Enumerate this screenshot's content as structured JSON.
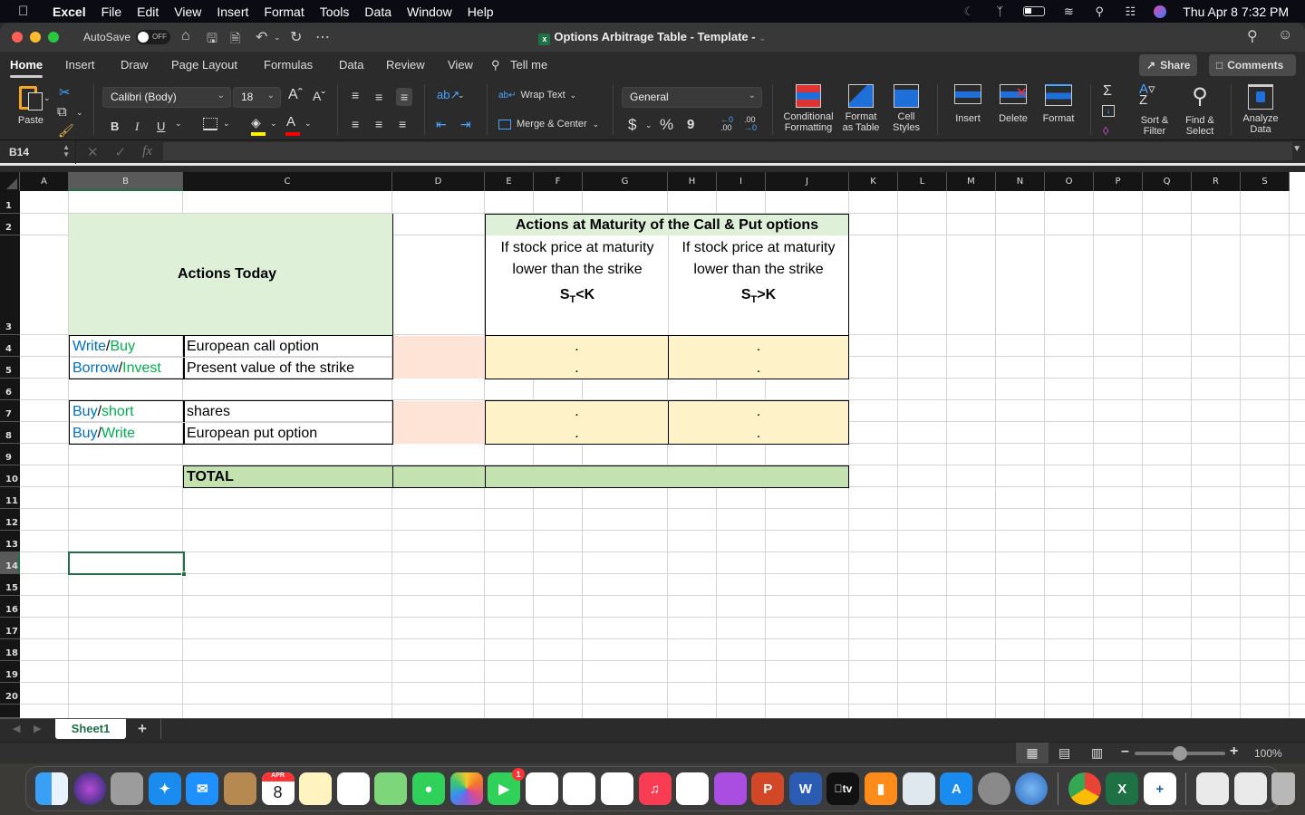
{
  "menubar": {
    "app": "Excel",
    "items": [
      "File",
      "Edit",
      "View",
      "Insert",
      "Format",
      "Tools",
      "Data",
      "Window",
      "Help"
    ],
    "clock": "Thu Apr 8  7:32 PM"
  },
  "titlebar": {
    "autosave_label": "AutoSave",
    "autosave_state": "OFF",
    "document_title": "Options Arbitrage Table - Template -"
  },
  "ribbon_tabs": [
    "Home",
    "Insert",
    "Draw",
    "Page Layout",
    "Formulas",
    "Data",
    "Review",
    "View"
  ],
  "tell_me": "Tell me",
  "share_label": "Share",
  "comments_label": "Comments",
  "ribbon": {
    "paste": "Paste",
    "font_name": "Calibri (Body)",
    "font_size": "18",
    "bold": "B",
    "italic": "I",
    "underline": "U",
    "wrap_text": "Wrap Text",
    "merge_center": "Merge & Center",
    "number_format": "General",
    "currency": "$",
    "percent": "%",
    "comma": "9",
    "conditional_formatting": [
      "Conditional",
      "Formatting"
    ],
    "format_as_table": [
      "Format",
      "as Table"
    ],
    "cell_styles": [
      "Cell",
      "Styles"
    ],
    "insert": "Insert",
    "delete": "Delete",
    "format": "Format",
    "sort_filter": [
      "Sort &",
      "Filter"
    ],
    "find_select": [
      "Find &",
      "Select"
    ],
    "analyze_data": [
      "Analyze",
      "Data"
    ]
  },
  "formula_bar": {
    "name_box": "B14",
    "formula": ""
  },
  "columns": [
    "A",
    "B",
    "C",
    "D",
    "E",
    "F",
    "G",
    "H",
    "I",
    "J",
    "K",
    "L",
    "M",
    "N",
    "O",
    "P",
    "Q",
    "R",
    "S"
  ],
  "rows": [
    "1",
    "2",
    "3",
    "4",
    "5",
    "6",
    "7",
    "8",
    "9",
    "10",
    "11",
    "12",
    "13",
    "14",
    "15",
    "16",
    "17",
    "18",
    "19",
    "20"
  ],
  "sheet": {
    "actions_today": "Actions Today",
    "maturity_header": "Actions at Maturity of the Call & Put options",
    "case1": {
      "line1": "If stock price at maturity",
      "line2": "lower than the strike",
      "formula_s": "S",
      "formula_sub": "T",
      "formula_rest": "<K"
    },
    "case2": {
      "line1": "If stock price at maturity",
      "line2": "lower than the strike",
      "formula_s": "S",
      "formula_sub": "T",
      "formula_rest": ">K"
    },
    "rows": [
      {
        "a": "Write",
        "sep": "/",
        "b": "Buy",
        "label": "European call option",
        "e": ".",
        "h": "."
      },
      {
        "a": "Borrow",
        "sep": "/",
        "b": "Invest",
        "label": "Present value of the strike",
        "e": ".",
        "h": "."
      },
      {
        "a": "Buy",
        "sep": "/",
        "b": "short",
        "label": "shares",
        "e": ".",
        "h": "."
      },
      {
        "a": "Buy",
        "sep": "/",
        "b": "Write",
        "label": "European put option",
        "e": ".",
        "h": "."
      }
    ],
    "total": "TOTAL",
    "selected_cell": "B14"
  },
  "colors": {
    "header_green": "#dff0d8",
    "total_green": "#c4e2b0",
    "peach": "#fde4d6",
    "yellow": "#fef3c8",
    "excel_green": "#1d7145",
    "blue_text": "#0070c0",
    "green_text": "#00b050"
  },
  "sheet_tabs": [
    "Sheet1"
  ],
  "status": {
    "zoom": "100%",
    "zoom_fraction": 0.5
  },
  "dock": [
    "Finder",
    "Siri",
    "Launchpad",
    "Safari",
    "Mail",
    "Contacts",
    "Calendar",
    "Notes",
    "Reminders",
    "Maps",
    "Messages",
    "Photos",
    "FaceTime",
    "Pages",
    "Numbers",
    "News",
    "Music",
    "Keynote",
    "Podcasts",
    "PowerPoint",
    "Word",
    "TV",
    "Books",
    "Preview",
    "App Store",
    "System Preferences",
    "Network Radar",
    "Chrome",
    "Excel",
    "Tableau",
    "Chrome Window",
    "Excel Window",
    "Trash"
  ],
  "dock_calendar": {
    "month": "APR",
    "day": "8"
  },
  "dock_facetime_badge": "1",
  "dock_tv_label": "tv"
}
